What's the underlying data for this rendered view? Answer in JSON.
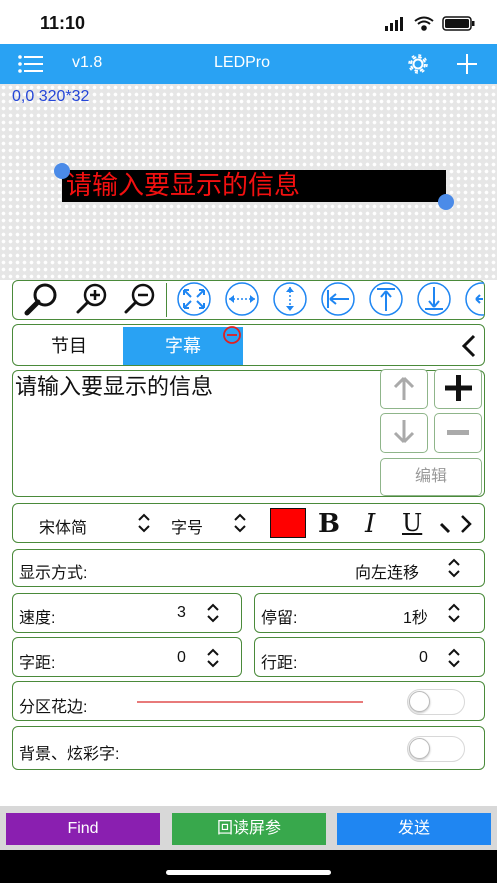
{
  "status_bar": {
    "time": "11:10"
  },
  "nav": {
    "version": "v1.8",
    "title": "LEDPro"
  },
  "preview": {
    "coords": "0,0 320*32",
    "led_text": "请输入要显示的信息"
  },
  "tabs": {
    "items": [
      "节目",
      "字幕"
    ]
  },
  "editor": {
    "text": "请输入要显示的信息",
    "edit_label": "编辑"
  },
  "font_row": {
    "font": "宋体简",
    "size_label": "字号",
    "color": "#ff0000",
    "bold": "B",
    "italic": "I",
    "underline": "U"
  },
  "display": {
    "label": "显示方式:",
    "value": "向左连移"
  },
  "speed": {
    "label": "速度:",
    "value": "3"
  },
  "stay": {
    "label": "停留:",
    "value": "1秒"
  },
  "char_spacing": {
    "label": "字距:",
    "value": "0"
  },
  "line_spacing": {
    "label": "行距:",
    "value": "0"
  },
  "border": {
    "label": "分区花边:",
    "enabled": false
  },
  "background": {
    "label": "背景、炫彩字:",
    "enabled": false
  },
  "bottom": {
    "find": "Find",
    "readback": "回读屏参",
    "send": "发送"
  },
  "colors": {
    "nav": "#29a2f3",
    "find": "#8a1fb0",
    "readback": "#38a84c",
    "send": "#1f86f2",
    "led_text": "#f21010"
  }
}
